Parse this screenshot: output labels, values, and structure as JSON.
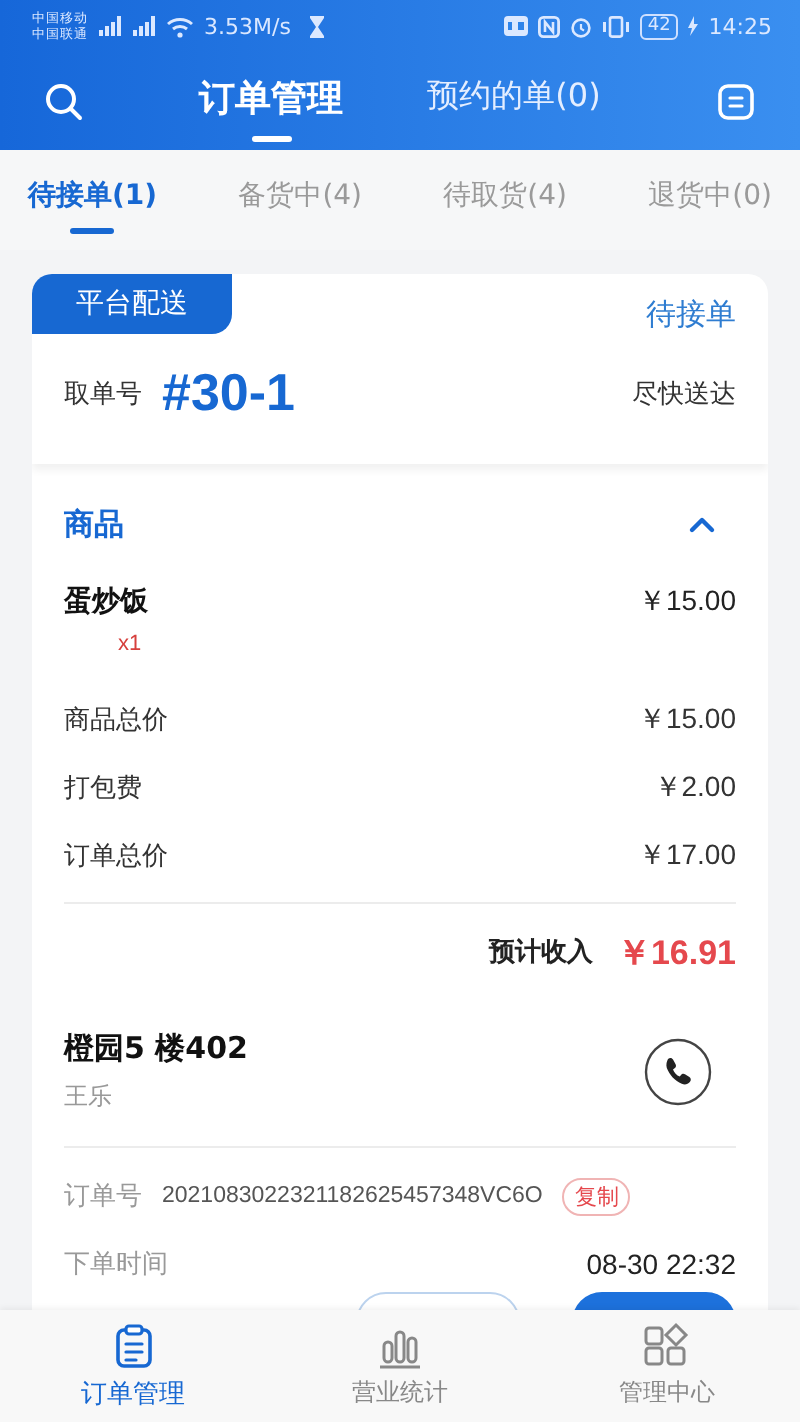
{
  "status_bar": {
    "carriers": [
      "中国移动",
      "中国联通"
    ],
    "speed": "3.53M/s",
    "battery": "42",
    "time": "14:25"
  },
  "header": {
    "tabs": [
      {
        "label": "订单管理",
        "selected": true
      },
      {
        "label": "预约的单(0)",
        "selected": false
      }
    ]
  },
  "order_tabs": [
    {
      "label": "待接单(1)",
      "selected": true
    },
    {
      "label": "备货中(4)",
      "selected": false
    },
    {
      "label": "待取货(4)",
      "selected": false
    },
    {
      "label": "退货中(0)",
      "selected": false
    }
  ],
  "order": {
    "delivery_badge": "平台配送",
    "status": "待接单",
    "pickup_label": "取单号",
    "pickup_number": "#30-1",
    "delivery_time": "尽快送达",
    "goods_title": "商品",
    "goods_expanded": true,
    "items": [
      {
        "name": "蛋炒饭",
        "qty": "x1",
        "price": "￥15.00"
      }
    ],
    "fees": [
      {
        "label": "商品总价",
        "value": "￥15.00"
      },
      {
        "label": "打包费",
        "value": "￥2.00"
      },
      {
        "label": "订单总价",
        "value": "￥17.00"
      }
    ],
    "income": {
      "label": "预计收入",
      "value": "￥16.91"
    },
    "address": "橙园5 楼402",
    "customer": "王乐",
    "order_no": {
      "label": "订单号",
      "value": "2021083022321182625457348VC6O",
      "copy": "复制"
    },
    "order_time": {
      "label": "下单时间",
      "value": "08-30 22:32"
    }
  },
  "bottom_nav": [
    {
      "label": "订单管理",
      "kind": "clipboard",
      "selected": true
    },
    {
      "label": "营业统计",
      "kind": "bars",
      "selected": false
    },
    {
      "label": "管理中心",
      "kind": "grid",
      "selected": false
    }
  ]
}
